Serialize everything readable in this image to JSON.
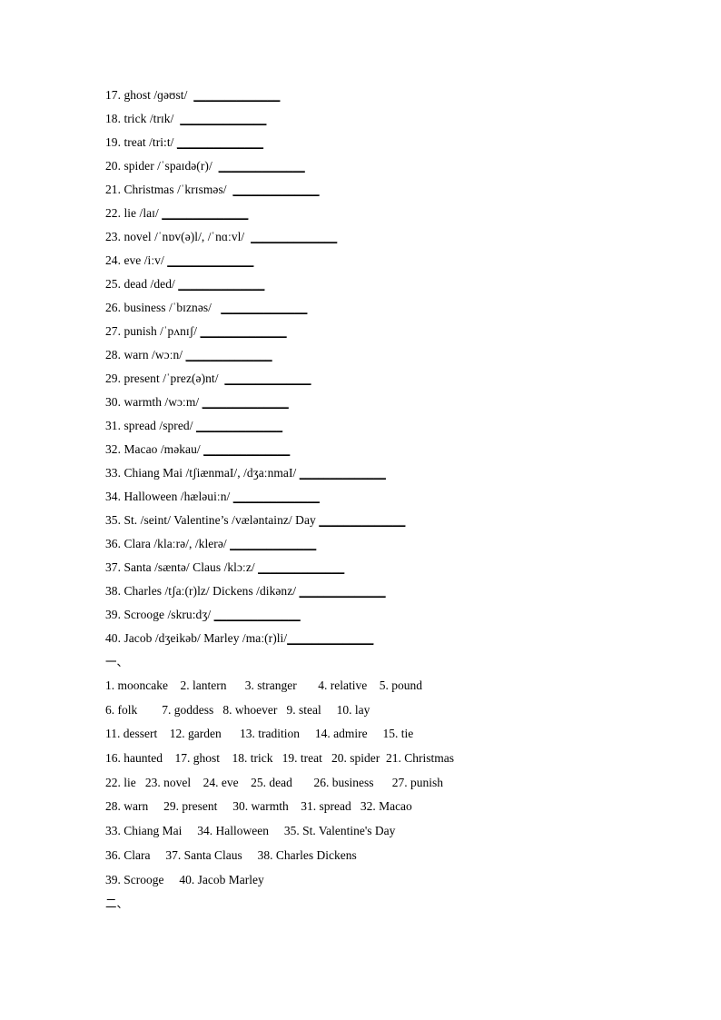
{
  "document": {
    "vocabulary_list": {
      "blank": "______________",
      "entries": [
        {
          "number": "17.",
          "text": "17. ghost /ɡəʊst/  "
        },
        {
          "number": "18.",
          "text": "18. trick /trɪk/  "
        },
        {
          "number": "19.",
          "text": "19. treat /tri:t/ "
        },
        {
          "number": "20.",
          "text": "20. spider /ˈspaɪdə(r)/  "
        },
        {
          "number": "21.",
          "text": "21. Christmas /ˈkrɪsməs/  "
        },
        {
          "number": "22.",
          "text": "22. lie /laɪ/ "
        },
        {
          "number": "23.",
          "text": "23. novel /ˈnɒv(ə)l/, /ˈnɑːvl/  "
        },
        {
          "number": "24.",
          "text": "24. eve /iːv/ "
        },
        {
          "number": "25.",
          "text": "25. dead /ded/ "
        },
        {
          "number": "26.",
          "text": "26. business /ˈbɪznəs/   "
        },
        {
          "number": "27.",
          "text": "27. punish /ˈpʌnɪʃ/ "
        },
        {
          "number": "28.",
          "text": "28. warn /wɔːn/ "
        },
        {
          "number": "29.",
          "text": "29. present /ˈprez(ə)nt/  "
        },
        {
          "number": "30.",
          "text": "30. warmth /wɔːm/ "
        },
        {
          "number": "31.",
          "text": "31. spread /spred/ "
        },
        {
          "number": "32.",
          "text": "32. Macao /məkau/ "
        },
        {
          "number": "33.",
          "text": "33. Chiang Mai /tʃiænmaI/, /dʒaːnmaI/ "
        },
        {
          "number": "34.",
          "text": "34. Halloween /hæləuiːn/ "
        },
        {
          "number": "35.",
          "text": "35. St. /seint/ Valentine’s /væləntainz/ Day "
        },
        {
          "number": "36.",
          "text": "36. Clara /klaːrə/, /klerə/ "
        },
        {
          "number": "37.",
          "text": "37. Santa /sæntə/ Claus /klɔːz/ "
        },
        {
          "number": "38.",
          "text": "38. Charles /tʃaː(r)lz/ Dickens /dikənz/ "
        },
        {
          "number": "39.",
          "text": "39. Scrooge /skru:dʒ/ "
        },
        {
          "number": "40.",
          "text": "40. Jacob /dʒeikəb/ Marley /maː(r)li/"
        }
      ]
    },
    "section_one_mark": "一、",
    "answer_key": [
      "1. mooncake    2. lantern      3. stranger       4. relative    5. pound",
      "6. folk        7. goddess   8. whoever   9. steal     10. lay",
      "11. dessert    12. garden      13. tradition     14. admire     15. tie",
      "16. haunted    17. ghost    18. trick   19. treat   20. spider  21. Christmas",
      "22. lie   23. novel    24. eve    25. dead       26. business      27. punish",
      "28. warn     29. present     30. warmth    31. spread   32. Macao",
      "33. Chiang Mai     34. Halloween     35. St. Valentine's Day",
      "36. Clara     37. Santa Claus     38. Charles Dickens",
      "39. Scrooge     40. Jacob Marley"
    ],
    "section_two_mark": "二、"
  }
}
